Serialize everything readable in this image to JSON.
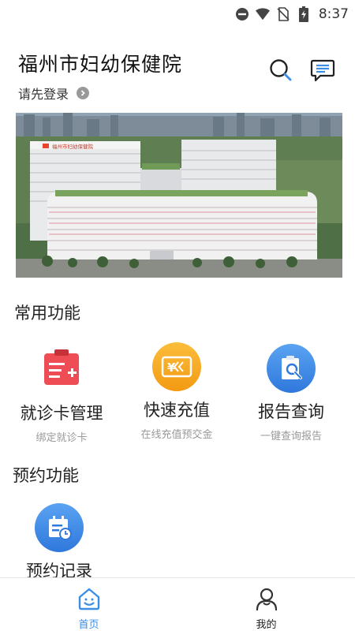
{
  "status_bar": {
    "time": "8:37",
    "icons": [
      "dnd-icon",
      "wifi-icon",
      "no-sim-icon",
      "battery-charging-icon"
    ]
  },
  "header": {
    "title": "福州市妇幼保健院",
    "login_prompt": "请先登录",
    "search_icon": "search-icon",
    "message_icon": "message-icon"
  },
  "banner": {
    "building_sign": "福州市妇幼保健院",
    "accent_color": "#f05a28"
  },
  "common": {
    "title": "常用功能",
    "items": [
      {
        "label": "就诊卡管理",
        "sub": "绑定就诊卡",
        "icon": "card-add-icon",
        "color": "#ee4d55"
      },
      {
        "label": "快速充值",
        "sub": "在线充值预交金",
        "icon": "yuan-card-icon",
        "color": "#f6a11c"
      },
      {
        "label": "报告查询",
        "sub": "一键查询报告",
        "icon": "report-search-icon",
        "color": "#3b82e6"
      }
    ]
  },
  "booking": {
    "title": "预约功能",
    "items": [
      {
        "label": "预约记录",
        "icon": "calendar-clock-icon",
        "color": "#3b82e6"
      }
    ]
  },
  "nav": {
    "home": "首页",
    "mine": "我的",
    "active_color": "#3a8ee6"
  }
}
